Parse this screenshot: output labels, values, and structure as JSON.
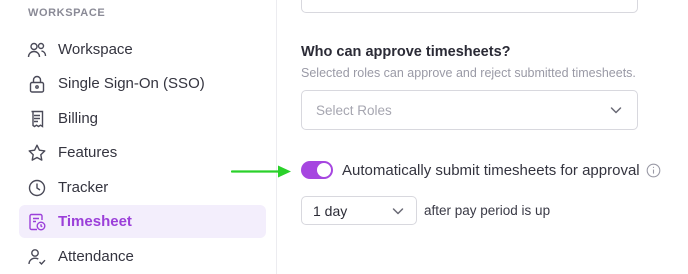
{
  "sidebar": {
    "section_title": "WORKSPACE",
    "items": [
      {
        "label": "Workspace",
        "icon": "users-icon"
      },
      {
        "label": "Single Sign-On (SSO)",
        "icon": "lock-icon"
      },
      {
        "label": "Billing",
        "icon": "receipt-icon"
      },
      {
        "label": "Features",
        "icon": "star-icon"
      },
      {
        "label": "Tracker",
        "icon": "clock-icon"
      },
      {
        "label": "Timesheet",
        "icon": "timesheet-icon",
        "active": true
      },
      {
        "label": "Attendance",
        "icon": "user-check-icon"
      }
    ]
  },
  "main": {
    "approve_title": "Who can approve timesheets?",
    "approve_subtitle": "Selected roles can approve and reject submitted timesheets.",
    "roles_placeholder": "Select Roles",
    "auto_submit_label": "Automatically submit timesheets for approval",
    "auto_submit_enabled": true,
    "delay_value": "1 day",
    "after_text": "after pay period is up"
  },
  "colors": {
    "accent": "#a646e0",
    "active_bg": "#f3eefc",
    "arrow": "#2ad12a"
  }
}
